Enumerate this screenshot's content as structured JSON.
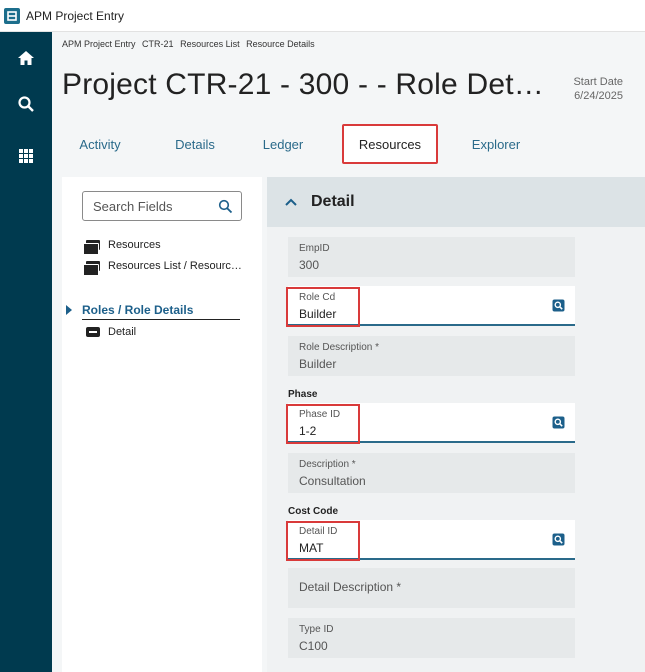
{
  "window": {
    "title": "APM Project Entry"
  },
  "breadcrumb": [
    "APM Project Entry",
    "CTR-21",
    "Resources List",
    "Resource Details"
  ],
  "page": {
    "title": "Project CTR-21 - 300 - - Role Det…",
    "start_date_label": "Start Date",
    "start_date_value": "6/24/2025"
  },
  "tabs": [
    {
      "label": "Activity",
      "active": false
    },
    {
      "label": "Details",
      "active": false
    },
    {
      "label": "Ledger",
      "active": false
    },
    {
      "label": "Resources",
      "active": true
    },
    {
      "label": "Explorer",
      "active": false
    }
  ],
  "nav": [
    {
      "icon": "home-icon"
    },
    {
      "icon": "search-icon"
    },
    {
      "icon": "apps-grid-icon"
    }
  ],
  "left_panel": {
    "search_placeholder": "Search Fields",
    "tree": [
      {
        "label": "Resources",
        "icon": "stack-icon"
      },
      {
        "label": "Resources List / Resourc…",
        "icon": "stack-icon"
      }
    ],
    "section": {
      "label": "Roles / Role Details"
    },
    "section_items": [
      {
        "label": "Detail",
        "icon": "detail-icon"
      }
    ]
  },
  "detail": {
    "title": "Detail",
    "fields": {
      "empid": {
        "label": "EmpID",
        "value": "300"
      },
      "role_cd": {
        "label": "Role Cd",
        "value": "Builder"
      },
      "role_desc": {
        "label": "Role Description *",
        "value": "Builder"
      },
      "phase_group": "Phase",
      "phase_id": {
        "label": "Phase ID",
        "value": "1-2"
      },
      "description": {
        "label": "Description *",
        "value": "Consultation"
      },
      "cost_code_group": "Cost Code",
      "detail_id": {
        "label": "Detail ID",
        "value": "MAT"
      },
      "detail_description": {
        "label": "Detail Description *"
      },
      "type_id": {
        "label": "Type ID",
        "value": "C100"
      }
    }
  },
  "colors": {
    "nav_rail": "#003a4f",
    "accent": "#2a6a8a",
    "highlight": "#d93a3a"
  }
}
